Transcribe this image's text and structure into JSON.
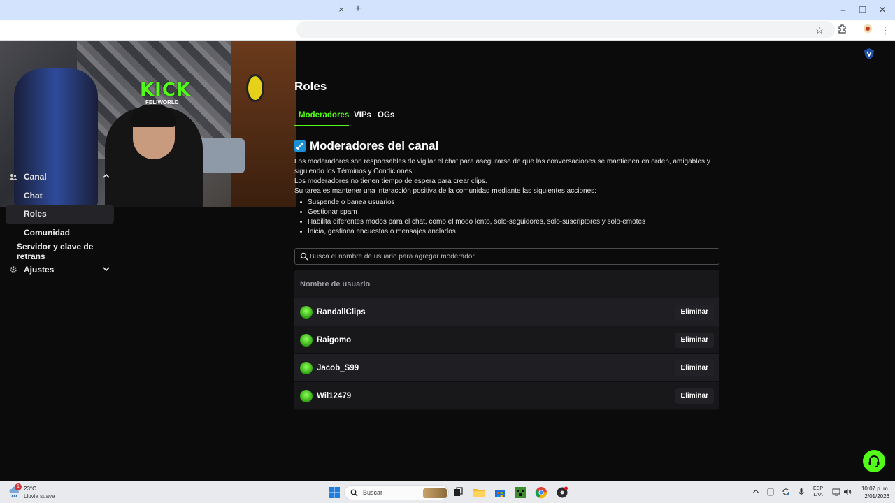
{
  "browser": {
    "tab_close": "×",
    "new_tab": "+",
    "window_min": "‒",
    "window_restore": "❐",
    "window_close": "✕"
  },
  "webcam": {
    "overlay_text": "KICK",
    "overlay_sub": "FELIWORLD"
  },
  "sidebar": {
    "items": [
      {
        "label": "Canal",
        "icon": "users-icon",
        "expanded": true
      },
      {
        "label": "Chat"
      },
      {
        "label": "Roles",
        "active": true
      },
      {
        "label": "Comunidad"
      },
      {
        "label": "Servidor y clave de retrans"
      },
      {
        "label": "Ajustes",
        "icon": "gear-icon",
        "expanded": false
      }
    ]
  },
  "main": {
    "title": "Roles",
    "tabs": [
      {
        "label": "Moderadores",
        "active": true
      },
      {
        "label": "VIPs"
      },
      {
        "label": "OGs"
      }
    ],
    "section_title": "Moderadores del canal",
    "description": [
      "Los moderadores son responsables de vigilar el chat para asegurarse de que las conversaciones se mantienen en orden, amigables y siguiendo los Términos y Condiciones.",
      "Los moderadores no tienen tiempo de espera para crear clips.",
      "Su tarea es mantener una interacción positiva de la comunidad mediante las siguientes acciones:"
    ],
    "bullets": [
      "Suspende o banea usuarios",
      "Gestionar spam",
      "Habilita diferentes modos para el chat, como el modo lento, solo-seguidores, solo-suscriptores y solo-emotes",
      "Inicia, gestiona encuestas o mensajes anclados"
    ],
    "search": {
      "placeholder": "Busca el nombre de usuario para agregar moderador",
      "value": ""
    },
    "table": {
      "header": "Nombre de usuario",
      "rows": [
        {
          "username": "RandallClips",
          "action": "Eliminar"
        },
        {
          "username": "Raigomo",
          "action": "Eliminar"
        },
        {
          "username": "Jacob_S99",
          "action": "Eliminar"
        },
        {
          "username": "Wil12479",
          "action": "Eliminar"
        }
      ]
    }
  },
  "taskbar": {
    "weather_badge": "1",
    "weather_temp": "23°C",
    "weather_desc": "Lluvia suave",
    "search_label": "Buscar",
    "lang_top": "ESP",
    "lang_bottom": "LAA",
    "time": "10:07 p. m.",
    "date": "2/01/2026"
  },
  "colors": {
    "accent": "#53fc18",
    "background": "#0b0b0c",
    "table_bg": "#18181b"
  }
}
